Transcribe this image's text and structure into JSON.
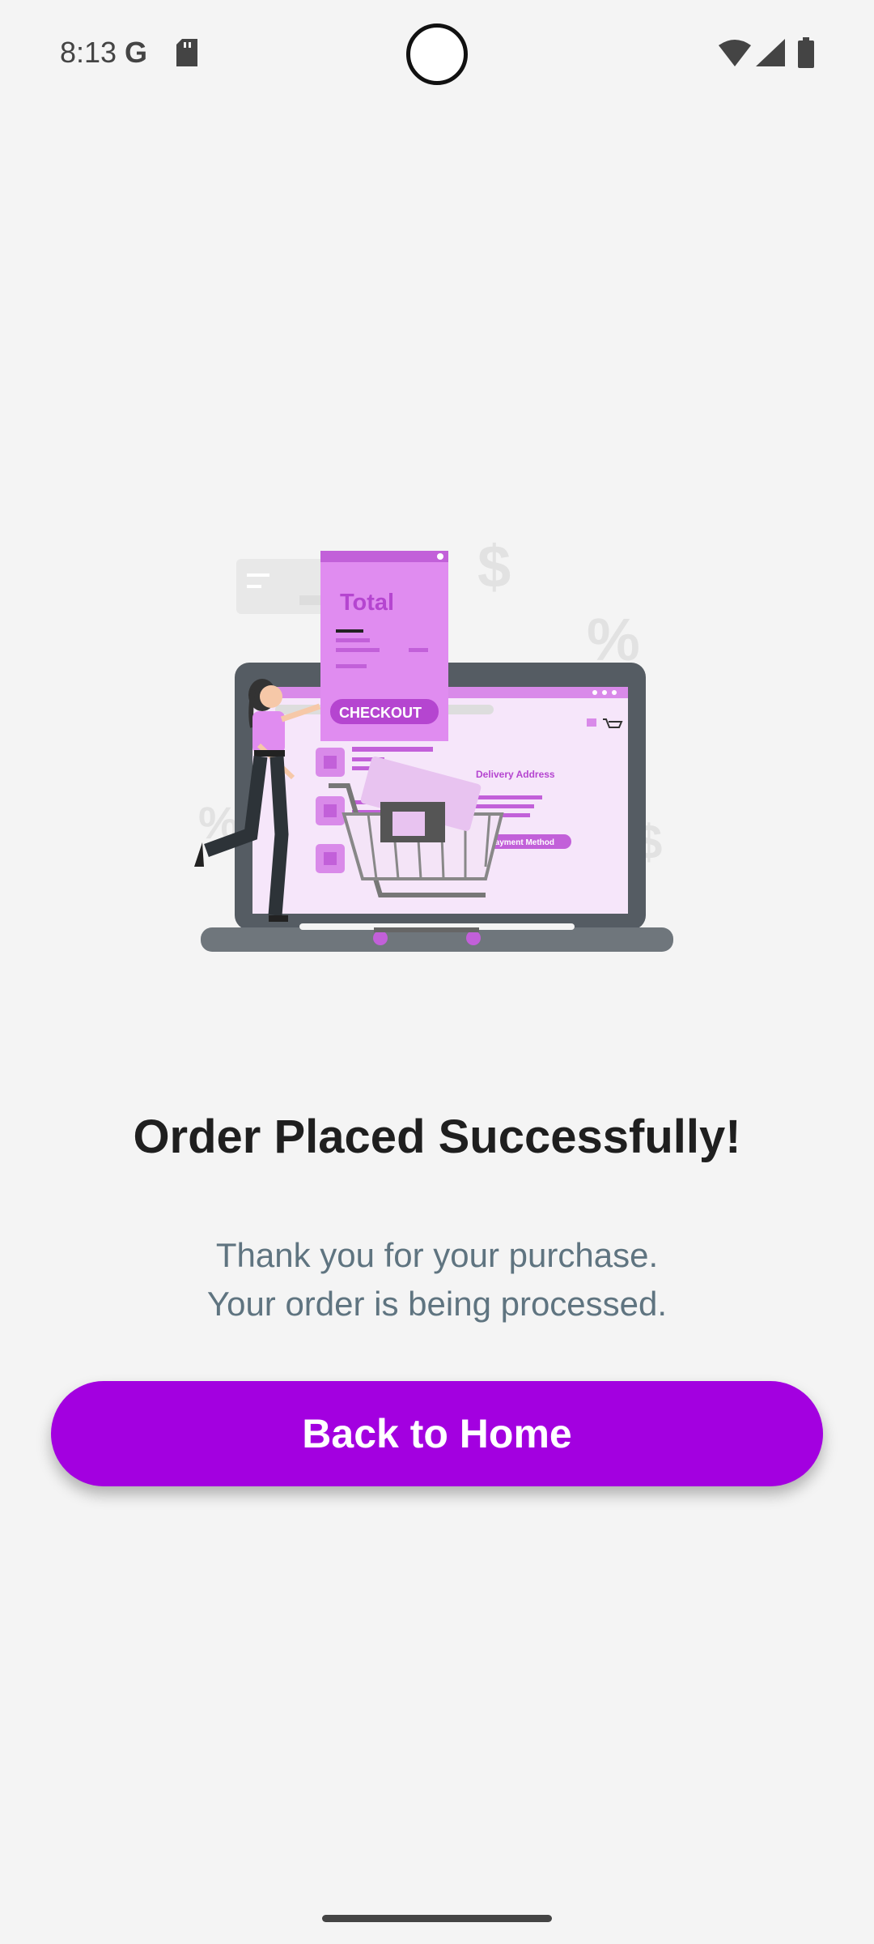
{
  "status_bar": {
    "time": "8:13",
    "google_icon": "G",
    "icons": [
      "google-icon",
      "sd-card-icon",
      "wifi-icon",
      "signal-icon",
      "battery-icon"
    ]
  },
  "illustration": {
    "receipt_title": "Total",
    "checkout_label": "CHECKOUT",
    "delivery_label": "Delivery Address",
    "payment_label": "Payment Method",
    "symbols": [
      "$",
      "%",
      "%",
      "$"
    ]
  },
  "main": {
    "title": "Order Placed Successfully!",
    "subtitle_line1": "Thank you for your purchase.",
    "subtitle_line2": "Your order is being processed.",
    "button_label": "Back to Home"
  },
  "colors": {
    "accent": "#a300e0",
    "background": "#f4f4f4",
    "illustration_purple": "#d98ae9"
  }
}
